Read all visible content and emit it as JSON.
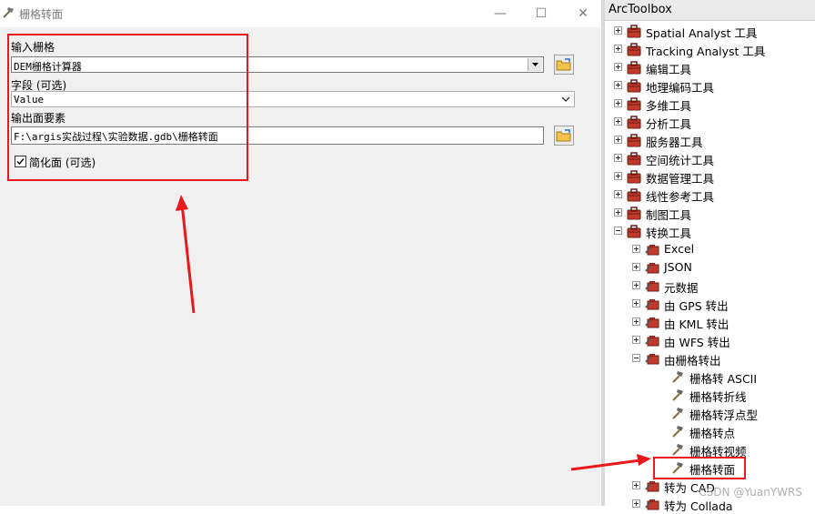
{
  "window": {
    "title": "栅格转面",
    "minimize_glyph": "—",
    "maximize_glyph": "☐",
    "close_glyph": "✕"
  },
  "form": {
    "input_raster_label": "输入栅格",
    "input_raster_value": "DEM栅格计算器",
    "field_label": "字段 (可选)",
    "field_value": "Value",
    "output_label": "输出面要素",
    "output_value": "F:\\argis实战过程\\实验数据.gdb\\栅格转面",
    "simplify_label": "简化面 (可选)",
    "simplify_checked": true
  },
  "toolbox": {
    "title": "ArcToolbox",
    "top_items": [
      "Spatial Analyst 工具",
      "Tracking Analyst 工具",
      "编辑工具",
      "地理编码工具",
      "多维工具",
      "分析工具",
      "服务器工具",
      "空间统计工具",
      "数据管理工具",
      "线性参考工具",
      "制图工具",
      "转换工具"
    ],
    "conversion_children": [
      "Excel",
      "JSON",
      "元数据",
      "由 GPS 转出",
      "由 KML 转出",
      "由 WFS 转出",
      "由栅格转出"
    ],
    "raster_tools": [
      "栅格转 ASCII",
      "栅格转折线",
      "栅格转浮点型",
      "栅格转点",
      "栅格转视频",
      "栅格转面"
    ],
    "after_items": [
      "转为 CAD",
      "转为 Collada"
    ]
  },
  "watermark": "CSDN @YuanYWRS",
  "colors": {
    "highlight": "#e8191c",
    "toolbox_icon": "#c0392b"
  }
}
